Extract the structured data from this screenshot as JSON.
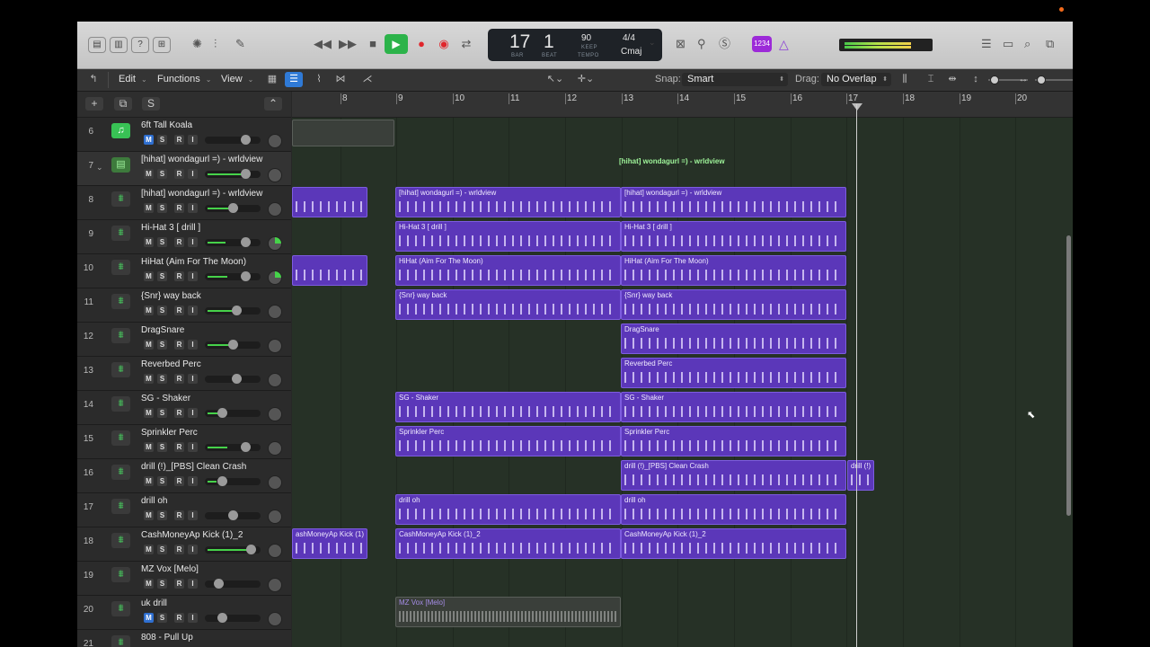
{
  "lcd": {
    "bar": "17",
    "beat": "1",
    "bar_label": "BAR",
    "beat_label": "BEAT",
    "tempo": "90",
    "keep": "KEEP",
    "tempo_label": "TEMPO",
    "time_signature": "4/4",
    "key": "Cmaj"
  },
  "badge": "1234",
  "toolbar": {
    "edit": "Edit",
    "functions": "Functions",
    "view": "View",
    "snap_label": "Snap:",
    "snap_value": "Smart",
    "drag_label": "Drag:",
    "drag_value": "No Overlap"
  },
  "track_header": {
    "add": "+",
    "duplicate": "⧉",
    "solo": "S"
  },
  "tracks": [
    {
      "num": "6",
      "name": "6ft Tall Koala"
    },
    {
      "num": "7",
      "name": "[hihat] wondagurl =) - wrldview"
    },
    {
      "num": "8",
      "name": "[hihat] wondagurl =) - wrldview"
    },
    {
      "num": "9",
      "name": "Hi-Hat 3 [ drill ]"
    },
    {
      "num": "10",
      "name": "HiHat (Aim For The Moon)"
    },
    {
      "num": "11",
      "name": "{Snr} way back"
    },
    {
      "num": "12",
      "name": "DragSnare"
    },
    {
      "num": "13",
      "name": "Reverbed Perc"
    },
    {
      "num": "14",
      "name": "SG - Shaker"
    },
    {
      "num": "15",
      "name": "Sprinkler Perc"
    },
    {
      "num": "16",
      "name": "drill (!)_[PBS] Clean Crash"
    },
    {
      "num": "17",
      "name": "drill oh"
    },
    {
      "num": "18",
      "name": "CashMoneyAp Kick (1)_2"
    },
    {
      "num": "19",
      "name": "MZ Vox [Melo]"
    },
    {
      "num": "20",
      "name": "uk drill"
    },
    {
      "num": "21",
      "name": "808 - Pull Up"
    }
  ],
  "msri": {
    "m": "M",
    "s": "S",
    "r": "R",
    "i": "I"
  },
  "ruler": [
    "8",
    "9",
    "10",
    "11",
    "12",
    "13",
    "14",
    "15",
    "16",
    "17",
    "18",
    "19",
    "20"
  ],
  "regions": {
    "folder_label": "[hihat] wondagurl =) - wrldview",
    "hihat_a": "[hihat] wondagurl =) - wrldview",
    "hihat_b": "[hihat] wondagurl =) - wrldview",
    "hh3_a": "Hi-Hat 3 [ drill ]",
    "hh3_b": "Hi-Hat 3 [ drill ]",
    "aim_a": "HiHat (Aim For The Moon)",
    "aim_b": "HiHat (Aim For The Moon)",
    "snr_a": "{Snr} way back",
    "snr_b": "{Snr} way back",
    "drag": "DragSnare",
    "reverb": "Reverbed Perc",
    "shaker_a": "SG - Shaker",
    "shaker_b": "SG - Shaker",
    "sprinkler_a": "Sprinkler Perc",
    "sprinkler_b": "Sprinkler Perc",
    "crash": "drill (!)_[PBS] Clean Crash",
    "crash_short": "drill (!)",
    "oh_a": "drill oh",
    "oh_b": "drill oh",
    "kick_left": "ashMoneyAp Kick (1)",
    "kick_a": "CashMoneyAp Kick (1)_2",
    "kick_b": "CashMoneyAp Kick (1)_2",
    "vox": "MZ Vox [Melo]"
  }
}
